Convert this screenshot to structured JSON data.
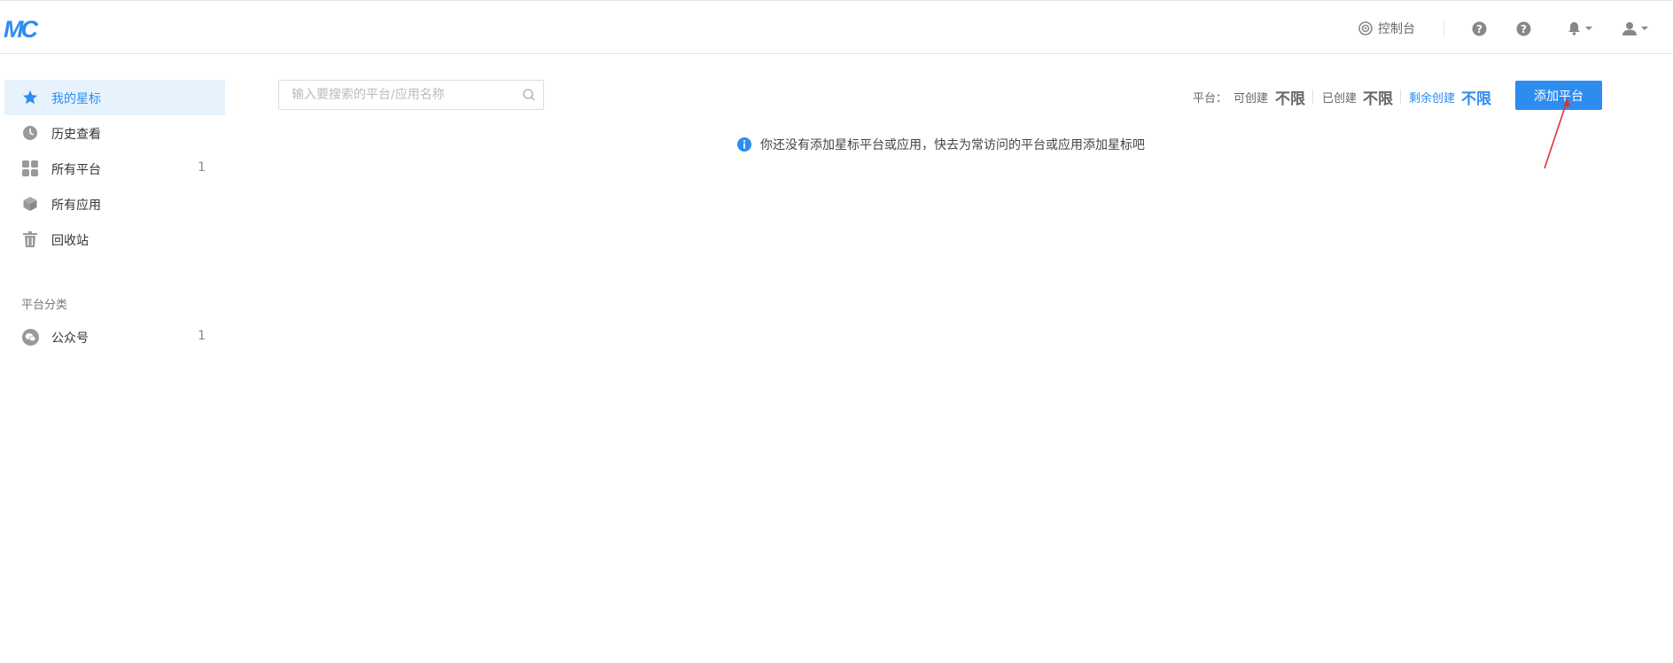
{
  "header": {
    "logo_text": "MC",
    "console_label": "控制台",
    "icons": [
      "console-icon",
      "help-icon",
      "help-icon",
      "bell-icon",
      "user-icon"
    ]
  },
  "sidebar": {
    "items": [
      {
        "label": "我的星标",
        "icon": "star-icon",
        "active": true,
        "count": ""
      },
      {
        "label": "历史查看",
        "icon": "clock-icon",
        "active": false,
        "count": ""
      },
      {
        "label": "所有平台",
        "icon": "grid-icon",
        "active": false,
        "count": "1"
      },
      {
        "label": "所有应用",
        "icon": "cube-icon",
        "active": false,
        "count": ""
      },
      {
        "label": "回收站",
        "icon": "trash-icon",
        "active": false,
        "count": ""
      }
    ],
    "section_title": "平台分类",
    "categories": [
      {
        "label": "公众号",
        "icon": "wechat-icon",
        "count": "1"
      }
    ]
  },
  "search": {
    "placeholder": "输入要搜索的平台/应用名称",
    "value": ""
  },
  "stats": {
    "platform_label": "平台：",
    "creatable_label": "可创建",
    "creatable_value": "不限",
    "created_label": "已创建",
    "created_value": "不限",
    "remaining_label": "剩余创建",
    "remaining_value": "不限"
  },
  "actions": {
    "add_platform_label": "添加平台"
  },
  "empty_notice": "你还没有添加星标平台或应用，快去为常访问的平台或应用添加星标吧",
  "colors": {
    "accent": "#2d8cf0",
    "active_bg": "#e6f3fd",
    "annotation_arrow": "#e0302f"
  }
}
